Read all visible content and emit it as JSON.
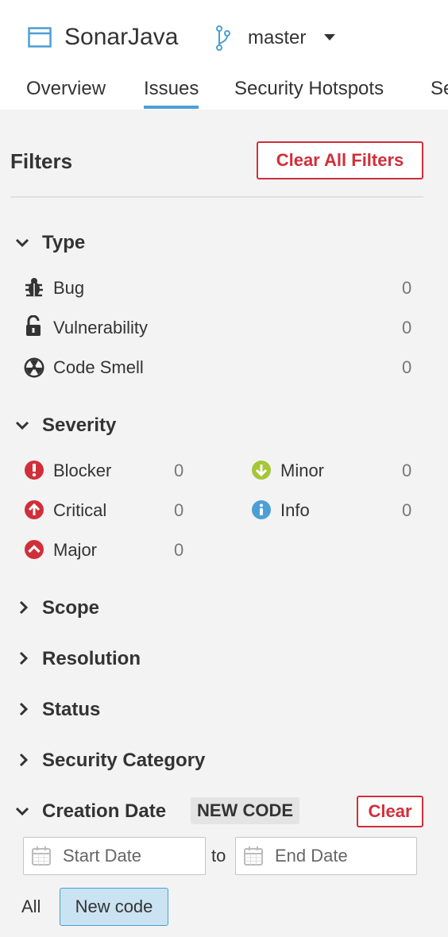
{
  "project": {
    "name": "SonarJava",
    "icon": "project-icon"
  },
  "branch": {
    "name": "master",
    "icon": "branch-icon"
  },
  "tabs": [
    {
      "label": "Overview"
    },
    {
      "label": "Issues",
      "active": true
    },
    {
      "label": "Security Hotspots"
    },
    {
      "label": "Se"
    }
  ],
  "filters": {
    "title": "Filters",
    "clear_all_label": "Clear All Filters"
  },
  "type": {
    "title": "Type",
    "expanded": true,
    "items": [
      {
        "label": "Bug",
        "count": "0",
        "icon": "bug-icon"
      },
      {
        "label": "Vulnerability",
        "count": "0",
        "icon": "lock-open-icon"
      },
      {
        "label": "Code Smell",
        "count": "0",
        "icon": "code-smell-icon"
      }
    ]
  },
  "severity": {
    "title": "Severity",
    "expanded": true,
    "items": [
      {
        "label": "Blocker",
        "count": "0",
        "icon": "blocker-icon"
      },
      {
        "label": "Critical",
        "count": "0",
        "icon": "critical-icon"
      },
      {
        "label": "Major",
        "count": "0",
        "icon": "major-icon"
      },
      {
        "label": "Minor",
        "count": "0",
        "icon": "minor-icon"
      },
      {
        "label": "Info",
        "count": "0",
        "icon": "info-icon"
      }
    ]
  },
  "collapsed_sections": [
    {
      "title": "Scope"
    },
    {
      "title": "Resolution"
    },
    {
      "title": "Status"
    },
    {
      "title": "Security Category"
    }
  ],
  "creation_date": {
    "title": "Creation Date",
    "badge": "NEW CODE",
    "clear_label": "Clear",
    "start_placeholder": "Start Date",
    "end_placeholder": "End Date",
    "to_label": "to",
    "all_label": "All",
    "new_code_label": "New code"
  },
  "colors": {
    "accent": "#4b9fd5",
    "danger": "#d02f3a",
    "minor": "#a4c639",
    "info": "#4b9fd5"
  }
}
